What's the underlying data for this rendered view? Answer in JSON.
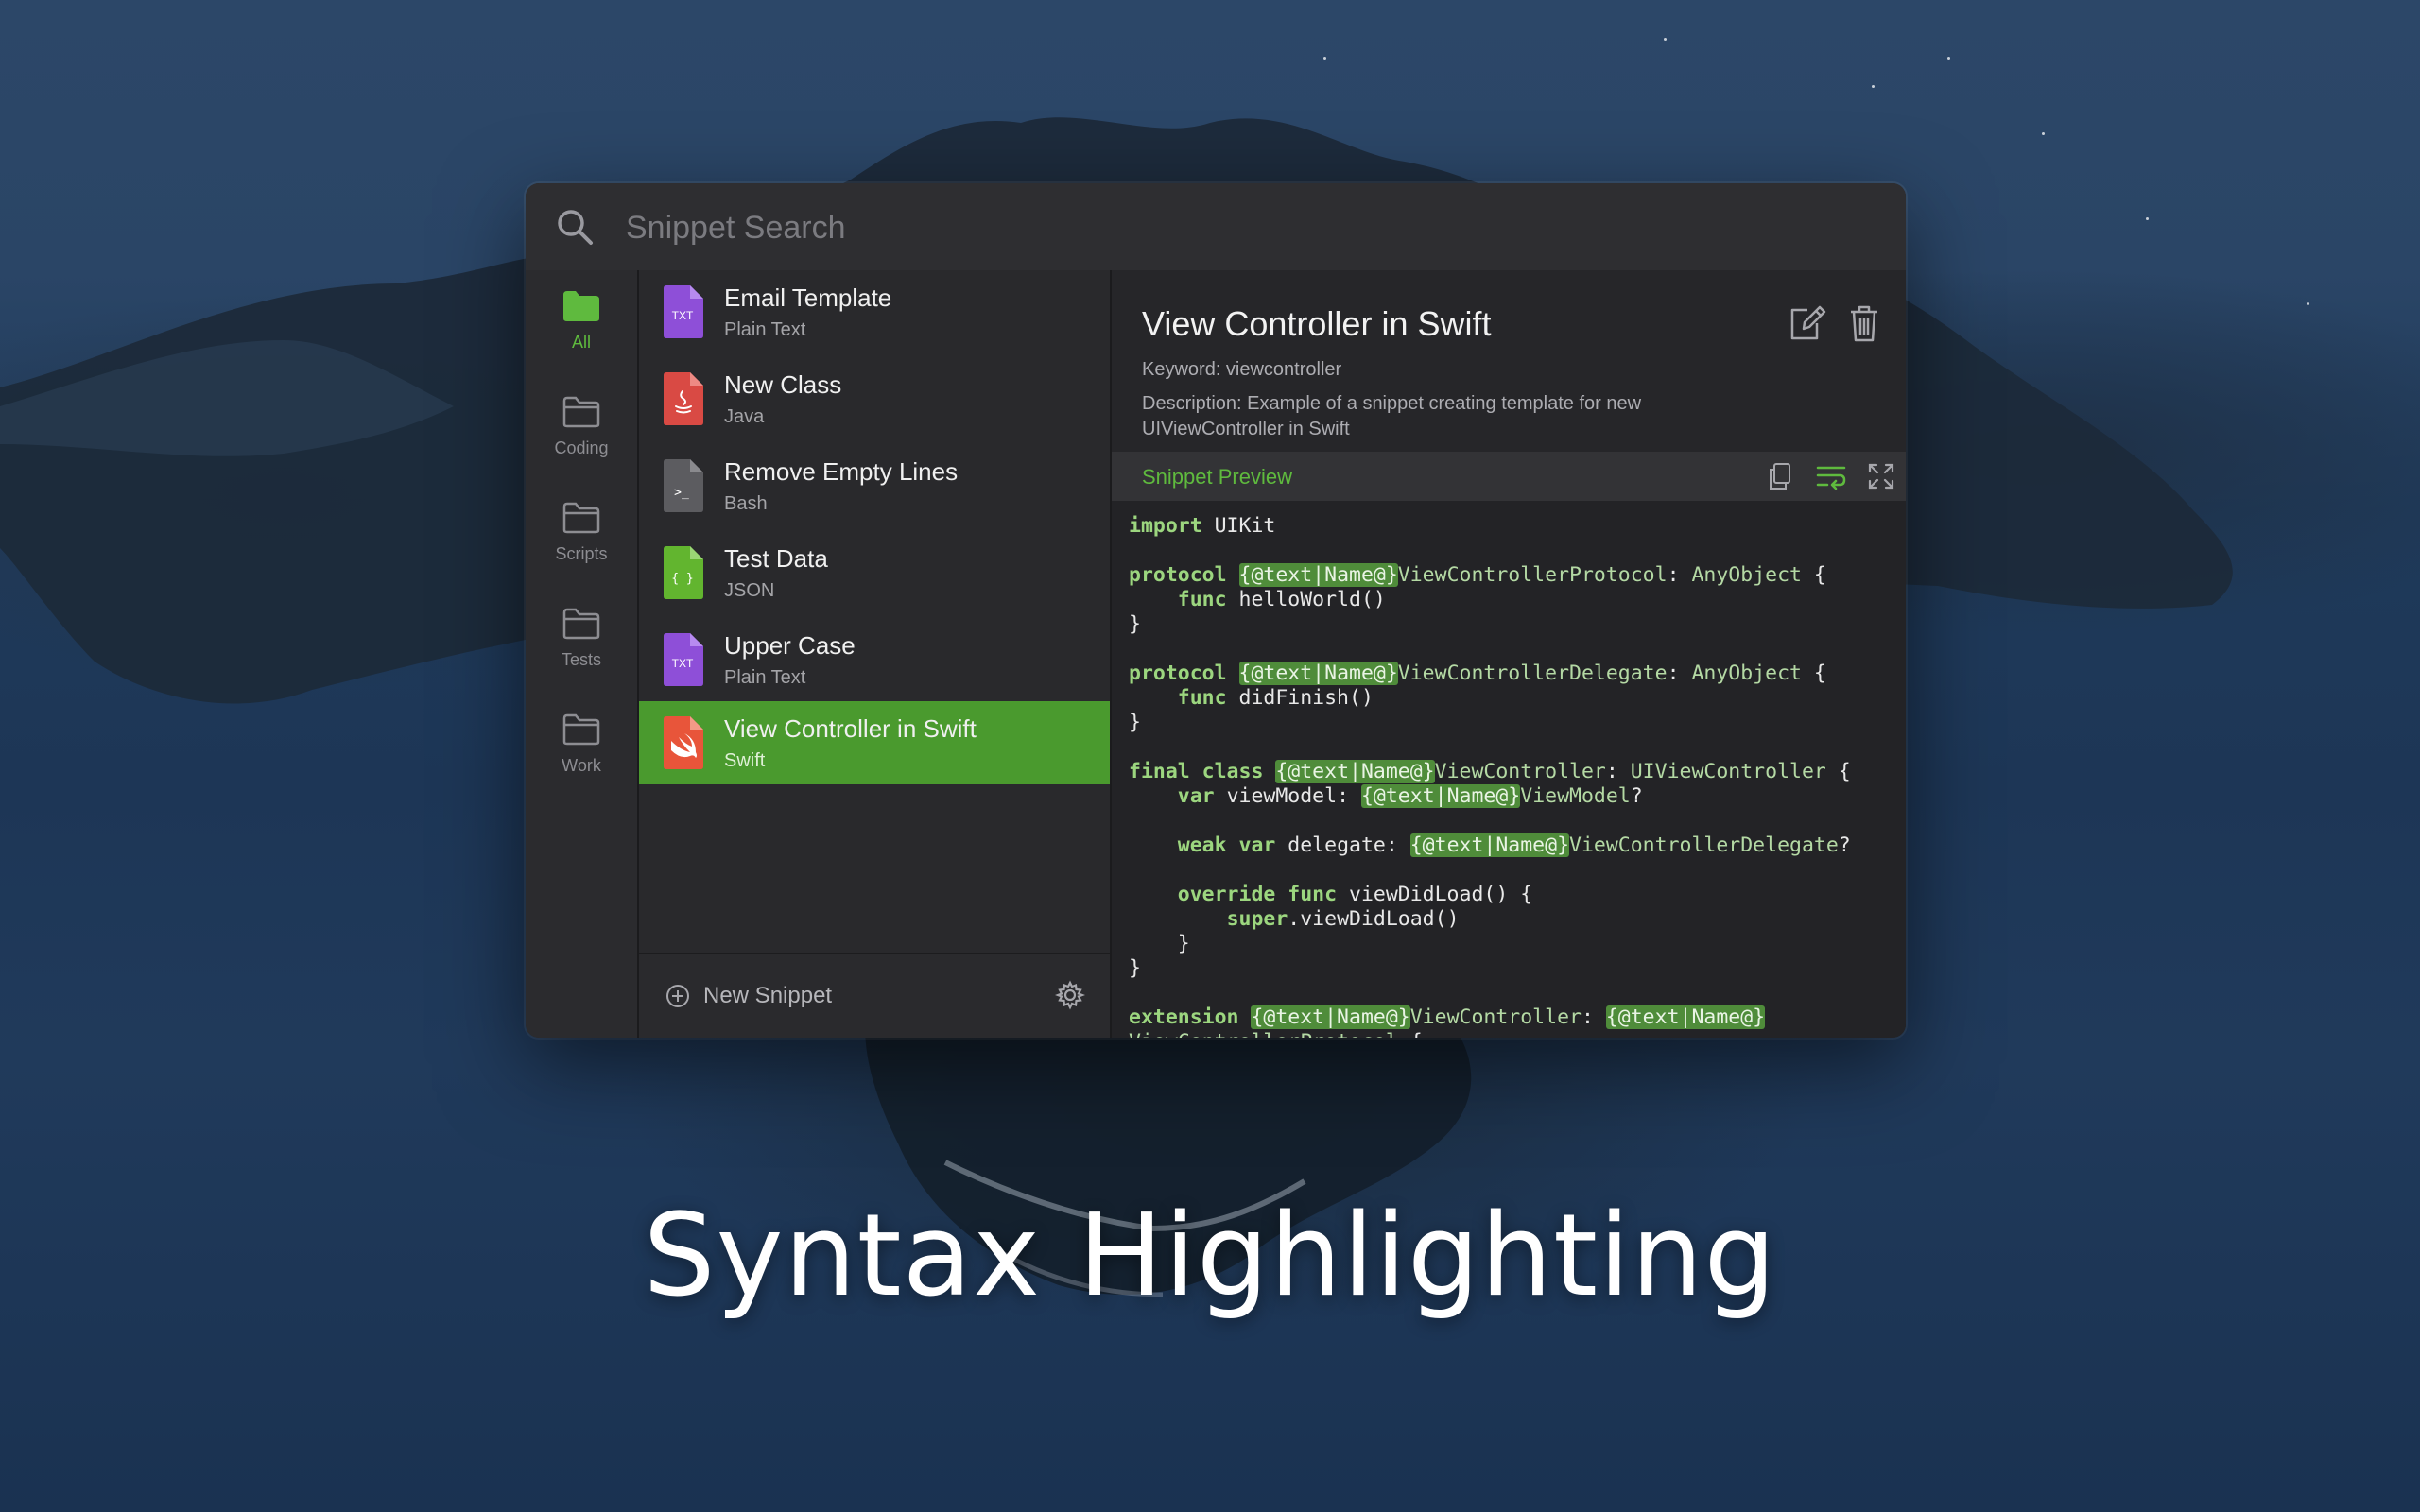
{
  "search": {
    "placeholder": "Snippet Search"
  },
  "sidebar": {
    "folders": [
      {
        "label": "All",
        "active": true
      },
      {
        "label": "Coding"
      },
      {
        "label": "Scripts"
      },
      {
        "label": "Tests"
      },
      {
        "label": "Work"
      }
    ]
  },
  "snippets": [
    {
      "title": "Email Template",
      "language": "Plain Text",
      "icon": "txt-file-icon",
      "icon_text": "TXT",
      "color": "#8e4fd8"
    },
    {
      "title": "New Class",
      "language": "Java",
      "icon": "java-file-icon",
      "color": "#d94a44"
    },
    {
      "title": "Remove Empty Lines",
      "language": "Bash",
      "icon": "bash-file-icon",
      "icon_text": ">_",
      "color": "#5c5c60"
    },
    {
      "title": "Test Data",
      "language": "JSON",
      "icon": "json-file-icon",
      "icon_text": "{ }",
      "color": "#62b52f"
    },
    {
      "title": "Upper Case",
      "language": "Plain Text",
      "icon": "txt-file-icon",
      "icon_text": "TXT",
      "color": "#8e4fd8"
    },
    {
      "title": "View Controller in Swift",
      "language": "Swift",
      "icon": "swift-file-icon",
      "color": "#e8553a",
      "selected": true
    }
  ],
  "footer": {
    "new_snippet_label": "New Snippet"
  },
  "detail": {
    "title": "View Controller in Swift",
    "keyword": "Keyword: viewcontroller",
    "description": "Description: Example of a snippet creating template for new UIViewController in Swift",
    "preview_label": "Snippet Preview"
  },
  "caption": "Syntax Highlighting",
  "colors": {
    "accent": "#5fba3e",
    "selection": "#4a9a2e",
    "window": "#262629"
  }
}
